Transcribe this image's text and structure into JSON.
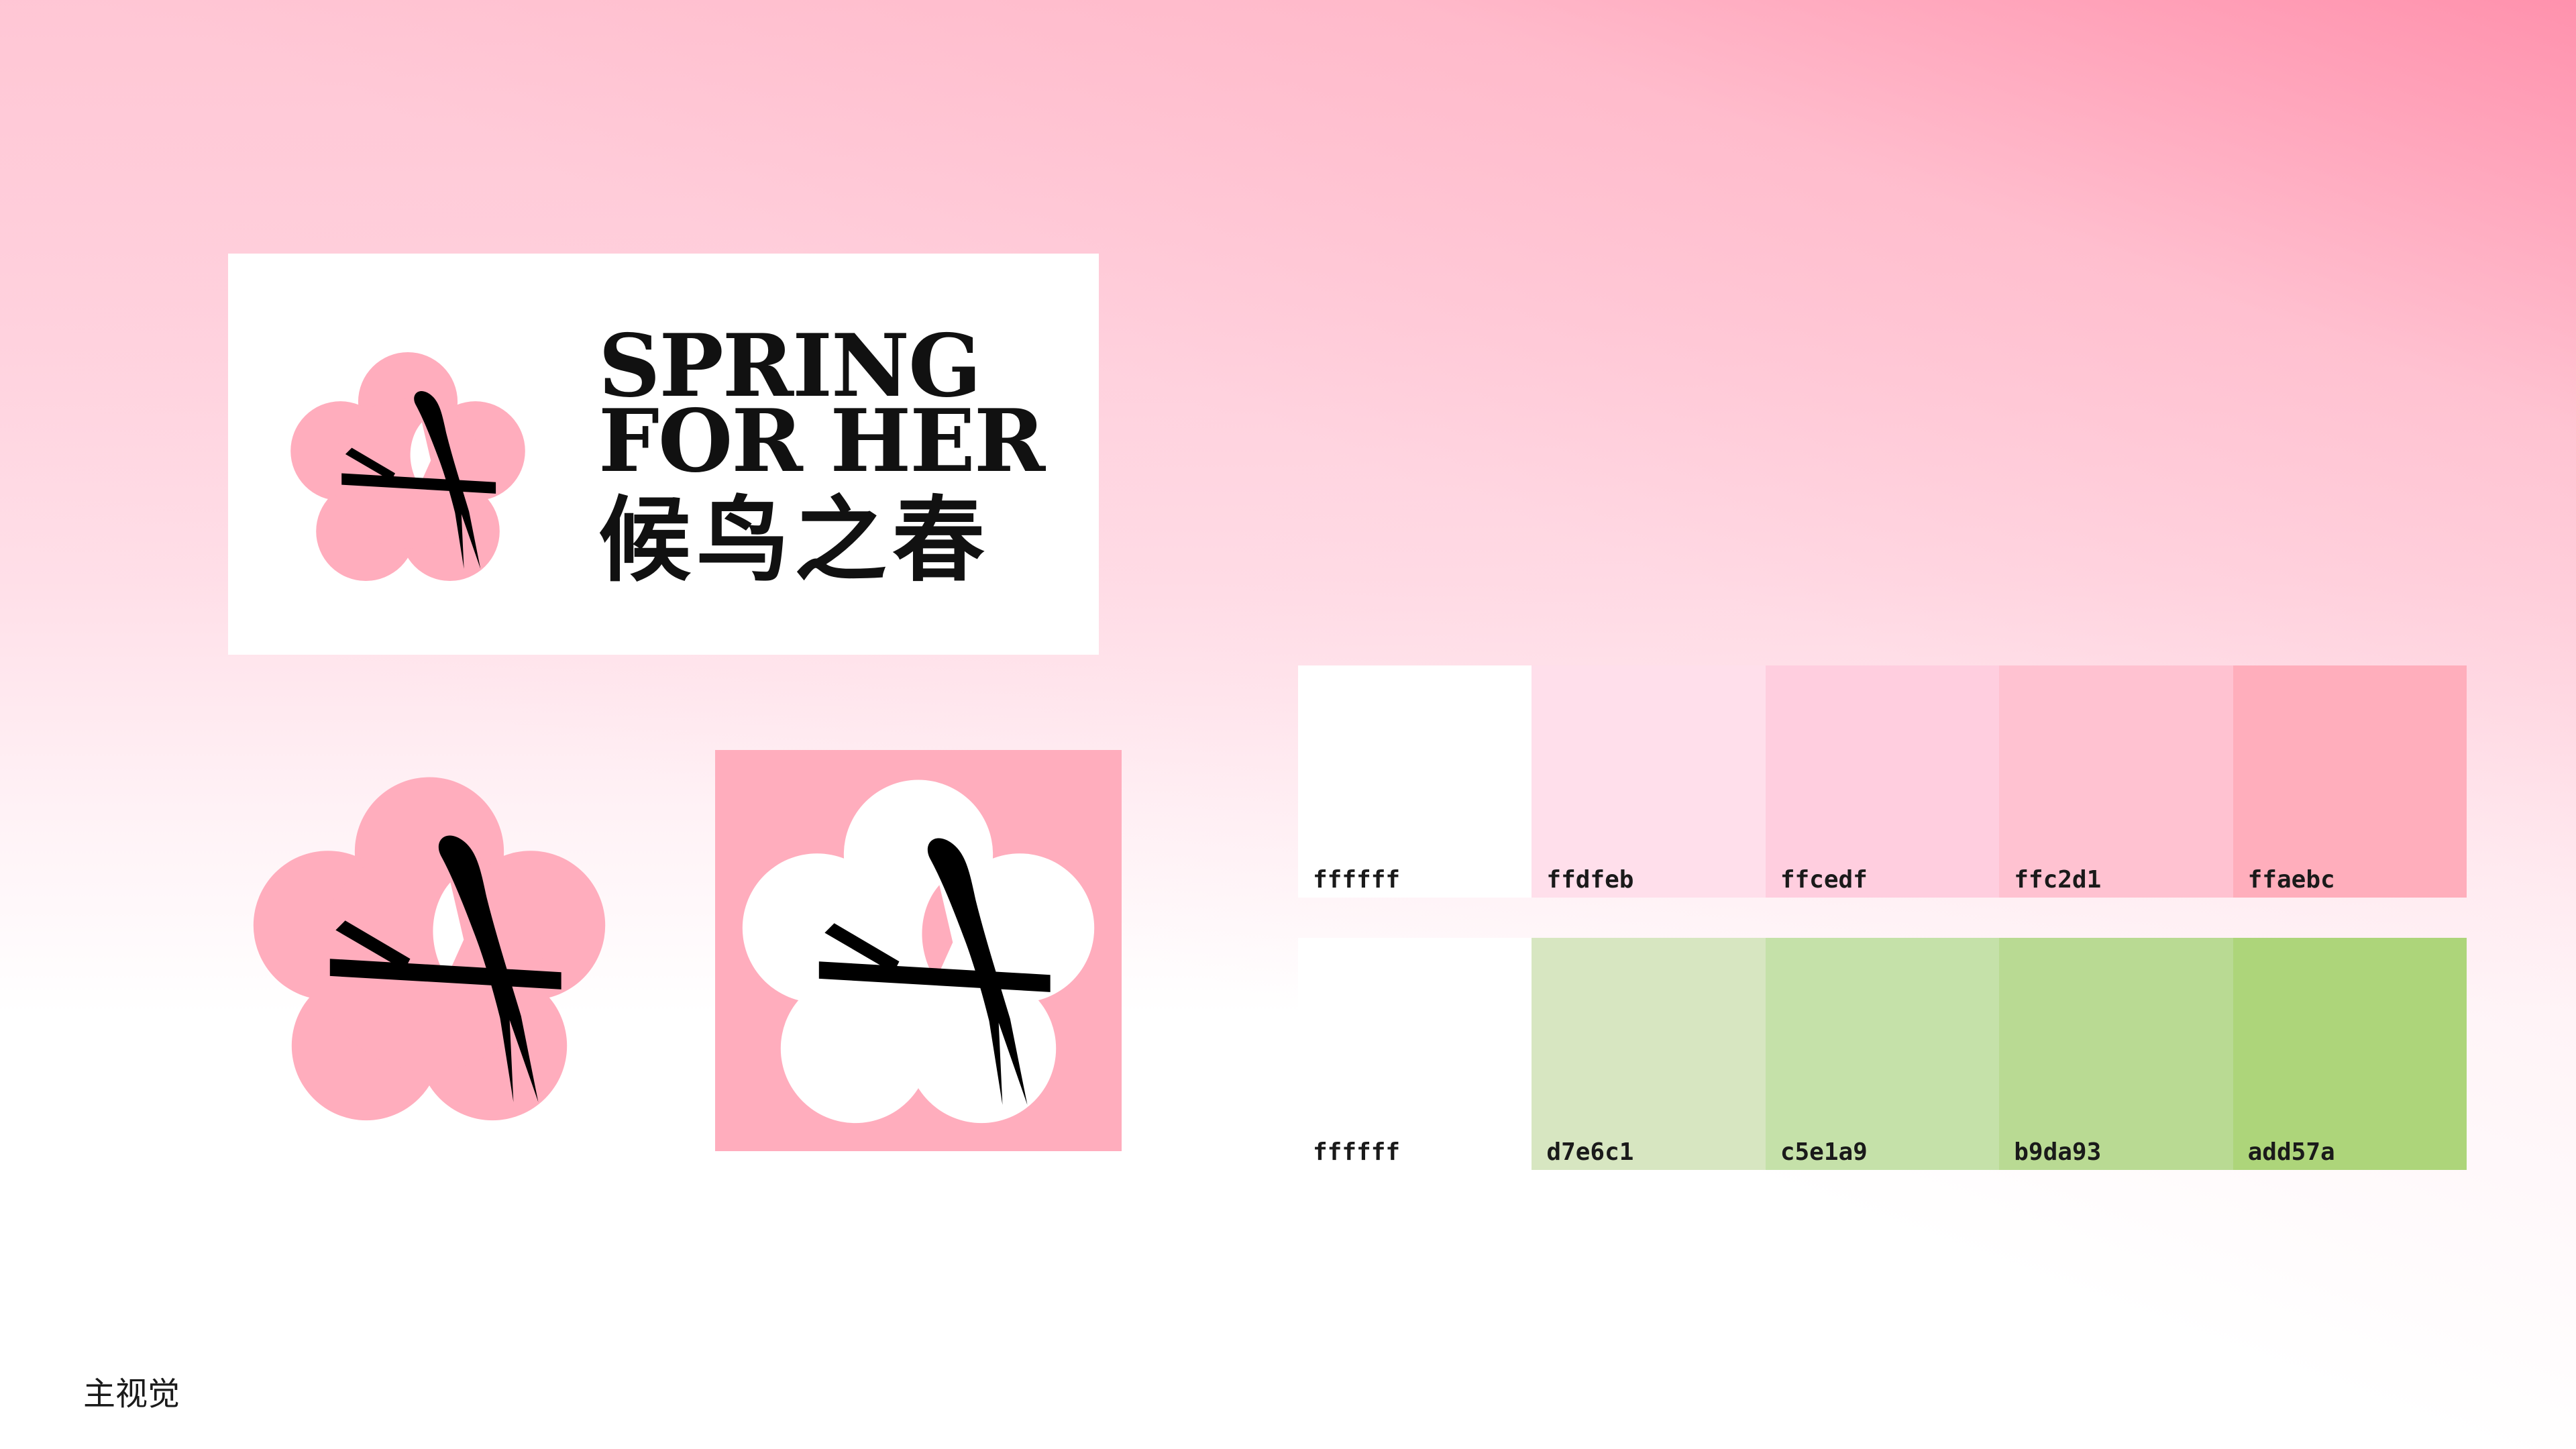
{
  "logo": {
    "title_line1": "SPRING",
    "title_line2": "FOR HER",
    "title_cn": "候鸟之春",
    "mark_icon": "plum-blossom-swallow-icon"
  },
  "colors": {
    "blossom_pink": "#ffadbd",
    "mark_black": "#000000",
    "card_white": "#ffffff"
  },
  "palette": {
    "pink": [
      {
        "hex": "ffffff",
        "color": "#ffffff"
      },
      {
        "hex": "ffdfeb",
        "color": "#ffdfeb"
      },
      {
        "hex": "ffcedf",
        "color": "#ffcedf"
      },
      {
        "hex": "ffc2d1",
        "color": "#ffc2d1"
      },
      {
        "hex": "ffaebc",
        "color": "#ffaebc"
      }
    ],
    "green": [
      {
        "hex": "ffffff",
        "color": "#ffffff"
      },
      {
        "hex": "d7e6c1",
        "color": "#d7e6c1"
      },
      {
        "hex": "c5e1a9",
        "color": "#c5e1a9"
      },
      {
        "hex": "b9da93",
        "color": "#b9da93"
      },
      {
        "hex": "add57a",
        "color": "#add57a"
      }
    ]
  },
  "caption": "主视觉"
}
